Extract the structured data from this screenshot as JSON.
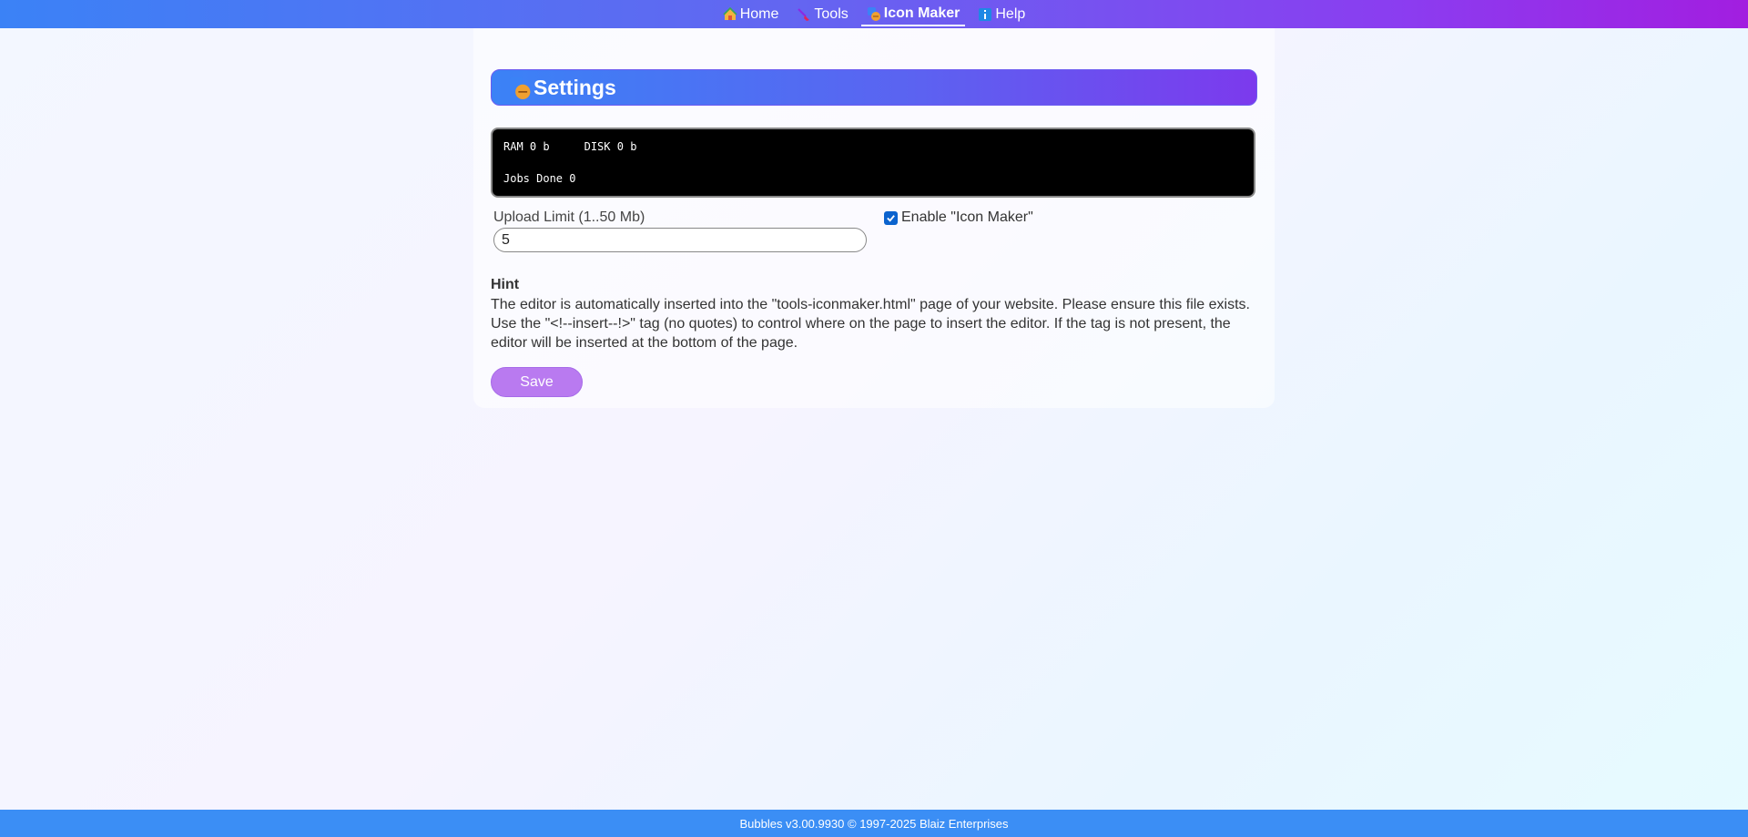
{
  "nav": {
    "items": [
      {
        "label": "Home",
        "icon": "house-icon",
        "active": false
      },
      {
        "label": "Tools",
        "icon": "brush-icon",
        "active": false
      },
      {
        "label": "Icon Maker",
        "icon": "icon-maker-icon",
        "active": true
      },
      {
        "label": "Help",
        "icon": "info-icon",
        "active": false
      }
    ]
  },
  "settings": {
    "title": "Settings",
    "icon": "icon-maker-icon"
  },
  "stats": {
    "ram_label": "RAM",
    "ram_value": "0 b",
    "disk_label": "DISK",
    "disk_value": "0 b",
    "jobs_label": "Jobs Done",
    "jobs_value": "0"
  },
  "form": {
    "upload_label": "Upload Limit (1..50 Mb)",
    "upload_value": "5",
    "enable_label": "Enable \"Icon Maker\"",
    "enable_checked": true
  },
  "hint": {
    "title": "Hint",
    "text": "The editor is automatically inserted into the \"tools-iconmaker.html\" page of your website. Please ensure this file exists. Use the \"<!--insert--!>\" tag (no quotes) to control where on the page to insert the editor. If the tag is not present, the editor will be inserted at the bottom of the page."
  },
  "actions": {
    "save_label": "Save"
  },
  "footer": {
    "text": "Bubbles v3.00.9930 © 1997-2025 Blaiz Enterprises"
  },
  "colors": {
    "accent": "#6366f1",
    "footer": "#3b8ef5",
    "save_button": "#b97af0",
    "checkbox": "#0b63ce"
  }
}
